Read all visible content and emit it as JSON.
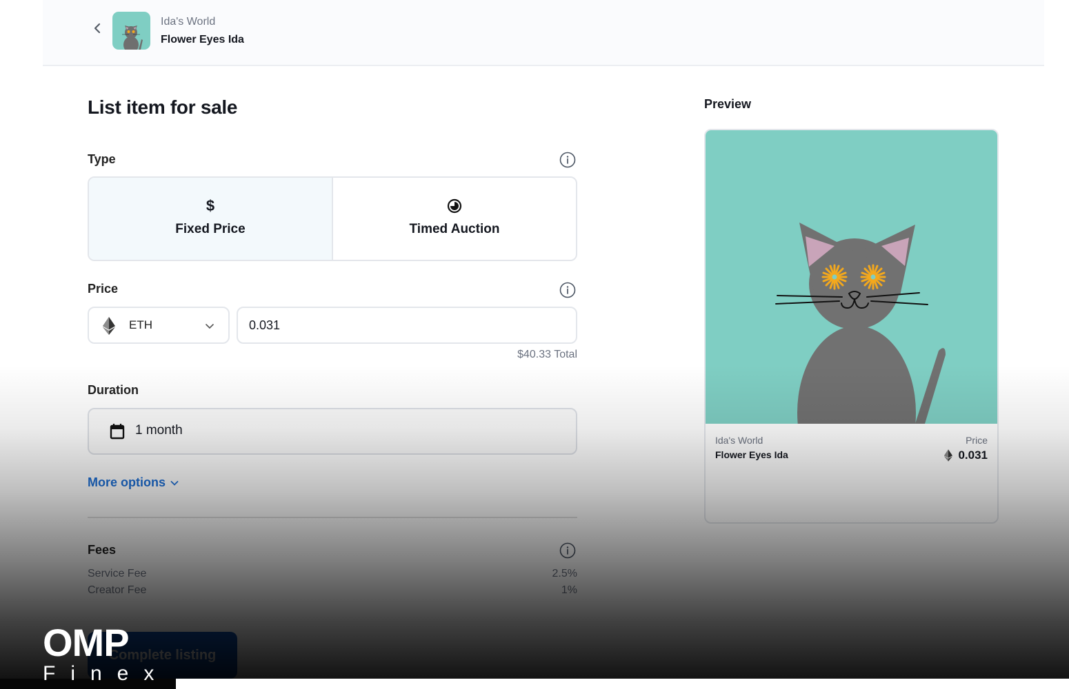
{
  "header": {
    "collection": "Ida's World",
    "title": "Flower Eyes Ida",
    "back_icon": "chevron-left-icon"
  },
  "main": {
    "page_title": "List item for sale",
    "type": {
      "label": "Type",
      "options": [
        {
          "label": "Fixed Price",
          "icon": "dollar-icon",
          "selected": true
        },
        {
          "label": "Timed Auction",
          "icon": "timer-icon",
          "selected": false
        }
      ]
    },
    "price": {
      "label": "Price",
      "currency": "ETH",
      "currency_icon": "ethereum-icon",
      "value": "0.031",
      "total": "$40.33 Total"
    },
    "duration": {
      "label": "Duration",
      "value": "1 month",
      "icon": "calendar-icon"
    },
    "more_options": "More options",
    "fees": {
      "label": "Fees",
      "rows": [
        {
          "name": "Service Fee",
          "value": "2.5%"
        },
        {
          "name": "Creator Fee",
          "value": "1%"
        }
      ]
    },
    "complete_button": "Complete listing"
  },
  "preview": {
    "label": "Preview",
    "collection": "Ida's World",
    "title": "Flower Eyes Ida",
    "price_label": "Price",
    "price": "0.031"
  },
  "watermark": {
    "line1": "OMP",
    "line2": "Finex"
  },
  "colors": {
    "accent": "#1d6fd6",
    "art_background": "#7fcec3",
    "selected_option_bg": "#f3f9fc"
  }
}
